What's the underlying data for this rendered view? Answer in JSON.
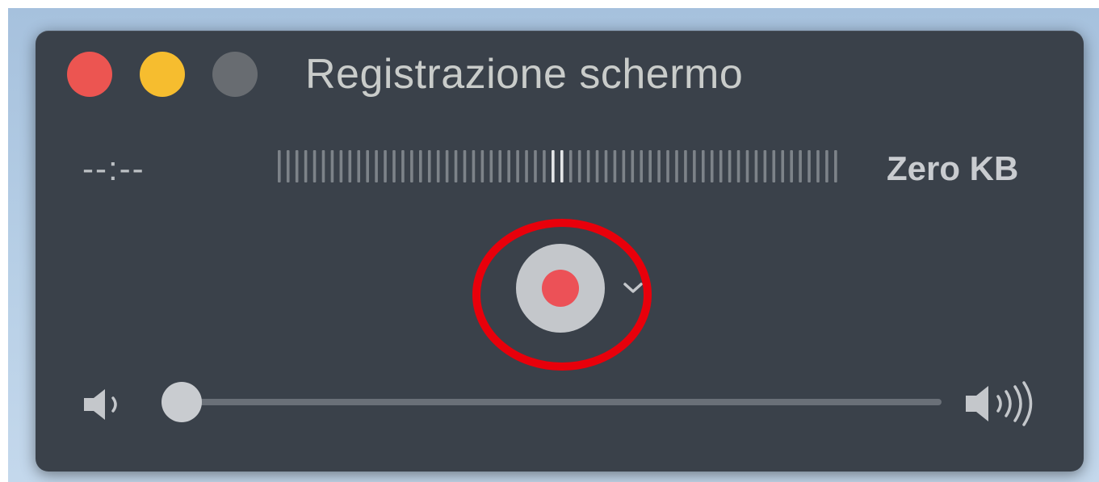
{
  "window": {
    "title": "Registrazione schermo",
    "controls": [
      "close",
      "minimize",
      "zoom"
    ]
  },
  "recording": {
    "elapsed_time": "--:--",
    "file_size": "Zero KB",
    "record_button_icon": "record-icon",
    "options_icon": "chevron-down-icon",
    "level_meter": {
      "bar_count": 64,
      "highlight_bars": [
        31,
        32
      ]
    }
  },
  "volume": {
    "low_icon": "speaker-low-icon",
    "high_icon": "speaker-high-icon",
    "level": 0.0
  },
  "annotation": {
    "shape": "ellipse",
    "color": "#e8000b",
    "target": "record-button"
  },
  "colors": {
    "window_bg": "#3a414a",
    "close": "#ec5551",
    "minimize": "#f6bd2f",
    "zoom_disabled": "#686c71",
    "record_red": "#ec5157",
    "control_gray": "#c4c7cb"
  }
}
